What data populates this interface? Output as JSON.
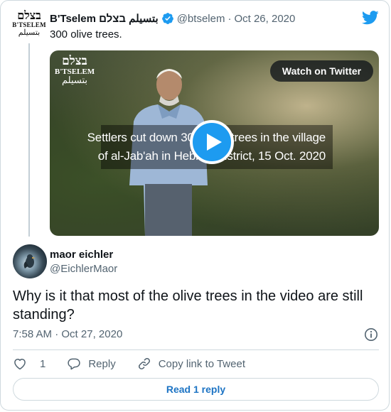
{
  "parent": {
    "avatar_line1": "בצלם",
    "avatar_line2": "B'TSELEM",
    "avatar_line3": "بتسيلم",
    "name": "B'Tselem بتسيلم בצלם",
    "handle": "@btselem",
    "separator": "·",
    "date": "Oct 26, 2020",
    "text": "300 olive trees.",
    "video": {
      "logo_line1": "בצלם",
      "logo_line2": "B'TSELEM",
      "logo_line3": "بتسيلم",
      "watch_label": "Watch on Twitter",
      "caption_line1": "Settlers cut down 300 olive trees in the village",
      "caption_line2": "of al-Jab'ah in Hebron District, 15 Oct. 2020"
    }
  },
  "reply": {
    "name": "maor eichler",
    "handle": "@EichlerMaor",
    "text": "Why is it that most of the olive trees in the video are still standing?",
    "time": "7:58 AM",
    "separator": "·",
    "date": "Oct 27, 2020",
    "like_count": "1",
    "reply_label": "Reply",
    "copy_label": "Copy link to Tweet",
    "read_replies_label": "Read 1 reply"
  },
  "colors": {
    "accent": "#1d9bf0",
    "muted": "#536471",
    "link": "#1d74c4",
    "border": "#cfd9de"
  },
  "icons": [
    "verified-badge-icon",
    "twitter-bird-icon",
    "play-icon",
    "info-icon",
    "heart-icon",
    "reply-bubble-icon",
    "link-icon"
  ]
}
